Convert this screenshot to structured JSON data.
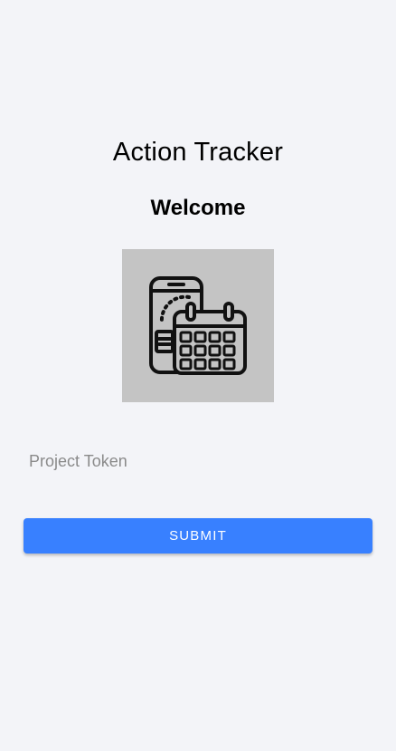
{
  "app": {
    "title": "Action Tracker",
    "welcome": "Welcome"
  },
  "logo": {
    "icon": "phone-calendar-icon",
    "background_color": "#c4c4c4"
  },
  "form": {
    "token_placeholder": "Project Token",
    "token_value": "",
    "submit_label": "SUBMIT"
  },
  "colors": {
    "background": "#f3f4f8",
    "primary": "#3880ff"
  }
}
